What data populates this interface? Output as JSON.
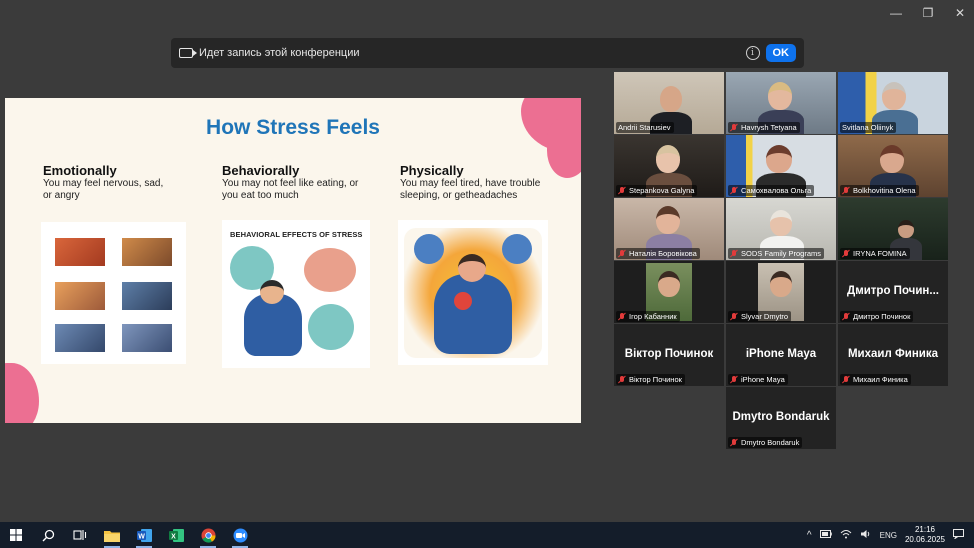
{
  "window": {
    "minimize": "—",
    "restore": "❐",
    "close": "✕"
  },
  "banner": {
    "text": "Идет запись этой конференции",
    "info": "i",
    "ok_label": "OK"
  },
  "slide": {
    "title": "How Stress Feels",
    "columns": [
      {
        "heading": "Emotionally",
        "body": "You  may  feel  nervous, sad, or angry"
      },
      {
        "heading": "Behaviorally",
        "body": "You may not feel like eating, or you eat too much"
      },
      {
        "heading": "Physically",
        "body": "You may feel tired, have trouble sleeping, or getheadaches"
      }
    ],
    "behavioral_caption": "BEHAVIORAL EFFECTS OF STRESS"
  },
  "participants": [
    {
      "name": "Andrii Starusiev",
      "muted": false,
      "video": true
    },
    {
      "name": "Havrysh Tetyana",
      "muted": true,
      "video": true
    },
    {
      "name": "Svitlana Oliinyk",
      "muted": false,
      "video": true,
      "active_speaker": true
    },
    {
      "name": "Stepankova Galyna",
      "muted": true,
      "video": true
    },
    {
      "name": "Самохвалова Ольга",
      "muted": true,
      "video": true
    },
    {
      "name": "Bolkhovitina Olena",
      "muted": true,
      "video": true
    },
    {
      "name": "Наталія Боровікова",
      "muted": true,
      "video": true
    },
    {
      "name": "SODS Family Programs",
      "muted": true,
      "video": true
    },
    {
      "name": "IRYNA FOMINA",
      "muted": true,
      "video": true
    },
    {
      "name": "Ігор Кабанник",
      "muted": true,
      "video": true
    },
    {
      "name": "Slyvar Dmytro",
      "muted": true,
      "video": true
    },
    {
      "name": "Дмитро Починок",
      "display": "Дмитро Почин...",
      "muted": true,
      "video": false
    },
    {
      "name": "Віктор Починок",
      "muted": true,
      "video": false
    },
    {
      "name": "iPhone Maya",
      "muted": true,
      "video": false
    },
    {
      "name": "Михаил Финика",
      "muted": true,
      "video": false
    },
    {
      "name": "Dmytro Bondaruk",
      "muted": true,
      "video": false
    }
  ],
  "taskbar": {
    "apps": [
      "start-icon",
      "search-icon",
      "task-view-icon",
      "file-explorer-icon",
      "word-icon",
      "excel-icon",
      "chrome-icon",
      "zoom-icon"
    ],
    "tray": {
      "chevron": "^",
      "language": "ENG",
      "time": "21:16",
      "date": "20.06.2025"
    }
  },
  "colors": {
    "zoom_blue": "#0e72ed",
    "active_speaker": "#23d959",
    "muted_red": "#e23b3b",
    "slide_title": "#1f75b8",
    "slide_accent": "#ec6f92"
  }
}
